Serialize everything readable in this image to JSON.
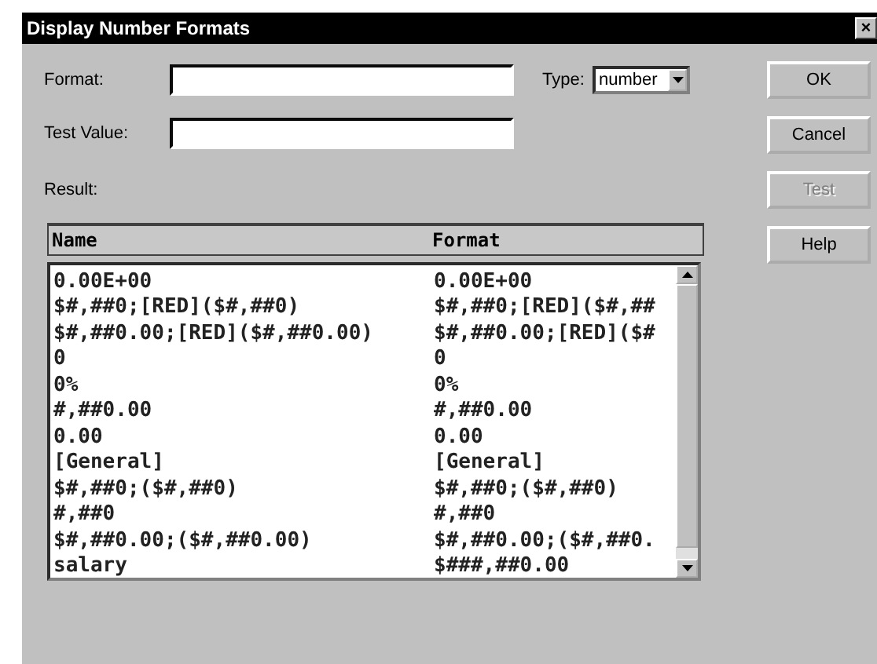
{
  "window": {
    "title": "Display Number Formats",
    "close": "×"
  },
  "fields": [
    {
      "label": "Format:"
    },
    {
      "label": "Test Value:"
    }
  ],
  "type": {
    "label": "Type:",
    "value": "number"
  },
  "result": {
    "label": "Result:"
  },
  "buttons": [
    {
      "label": "OK",
      "disabled": false
    },
    {
      "label": "Cancel",
      "disabled": false
    },
    {
      "label": "Test",
      "disabled": true
    },
    {
      "label": "Help",
      "disabled": false
    }
  ],
  "table": {
    "columns": [
      "Name",
      "Format"
    ],
    "rows": [
      {
        "name": "0.00E+00",
        "format": "0.00E+00"
      },
      {
        "name": "$#,##0;[RED]($#,##0)",
        "format": "$#,##0;[RED]($#,##"
      },
      {
        "name": "$#,##0.00;[RED]($#,##0.00)",
        "format": "$#,##0.00;[RED]($#"
      },
      {
        "name": "0",
        "format": "0"
      },
      {
        "name": "0%",
        "format": "0%"
      },
      {
        "name": "#,##0.00",
        "format": "#,##0.00"
      },
      {
        "name": "0.00",
        "format": "0.00"
      },
      {
        "name": "[General]",
        "format": "[General]"
      },
      {
        "name": "$#,##0;($#,##0)",
        "format": "$#,##0;($#,##0)"
      },
      {
        "name": "#,##0",
        "format": "#,##0"
      },
      {
        "name": "$#,##0.00;($#,##0.00)",
        "format": "$#,##0.00;($#,##0."
      },
      {
        "name": "salary",
        "format": "$###,##0.00"
      }
    ]
  }
}
